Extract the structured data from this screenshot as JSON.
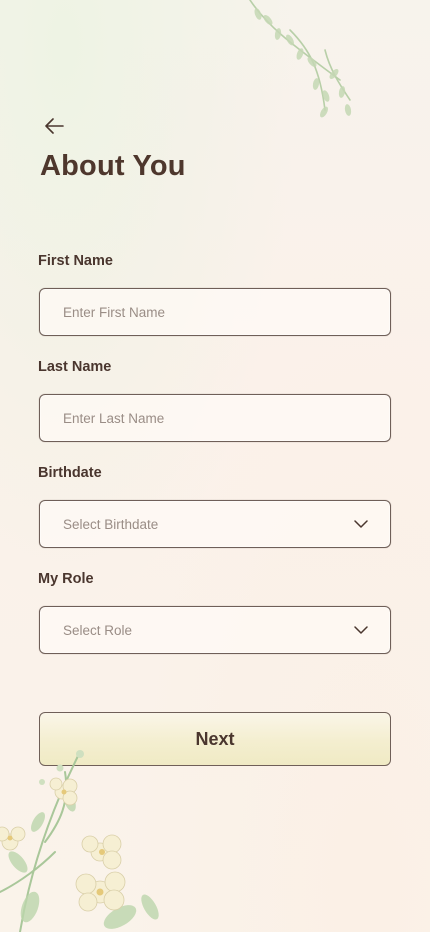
{
  "header": {
    "back_icon": "arrow-left-icon",
    "title": "About You"
  },
  "form": {
    "first_name": {
      "label": "First Name",
      "placeholder": "Enter First Name",
      "value": ""
    },
    "last_name": {
      "label": "Last Name",
      "placeholder": "Enter Last Name",
      "value": ""
    },
    "birthdate": {
      "label": "Birthdate",
      "selected_text": "Select Birthdate",
      "icon": "chevron-down-icon"
    },
    "role": {
      "label": "My Role",
      "selected_text": "Select Role",
      "icon": "chevron-down-icon"
    }
  },
  "actions": {
    "next_label": "Next"
  },
  "colors": {
    "text": "#4a362e",
    "border": "#6f5f58",
    "placeholder": "#9a8d86",
    "leaf": "#a9c79a",
    "flower": "#f4eccc"
  }
}
